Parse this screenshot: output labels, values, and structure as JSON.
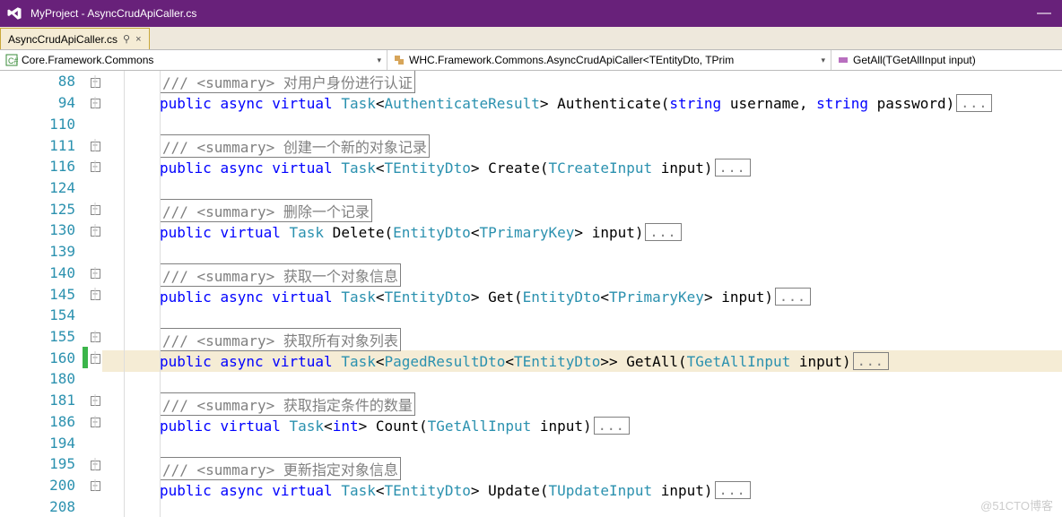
{
  "titlebar": {
    "title": "MyProject - AsyncCrudApiCaller.cs"
  },
  "tab": {
    "label": "AsyncCrudApiCaller.cs",
    "pin_glyph": "⚲",
    "close_glyph": "×"
  },
  "nav": {
    "namespace": "Core.Framework.Commons",
    "class": "WHC.Framework.Commons.AsyncCrudApiCaller<TEntityDto, TPrim",
    "member": "GetAll(TGetAllInput input)"
  },
  "lines": [
    {
      "n": 88,
      "expand": true,
      "kind": "summary",
      "summary": " 对用户身份进行认证"
    },
    {
      "n": 94,
      "expand": true,
      "kind": "sig",
      "tokens": [
        [
          "kw",
          "public"
        ],
        [
          "sp",
          " "
        ],
        [
          "kw",
          "async"
        ],
        [
          "sp",
          " "
        ],
        [
          "kw",
          "virtual"
        ],
        [
          "sp",
          " "
        ],
        [
          "type",
          "Task"
        ],
        [
          "pl",
          "<"
        ],
        [
          "type",
          "AuthenticateResult"
        ],
        [
          "pl",
          "> Authenticate("
        ],
        [
          "kw",
          "string"
        ],
        [
          "pl",
          " username, "
        ],
        [
          "kw",
          "string"
        ],
        [
          "pl",
          " password)"
        ]
      ],
      "ellipsis": true
    },
    {
      "n": 110,
      "kind": "blank"
    },
    {
      "n": 111,
      "expand": true,
      "kind": "summary",
      "summary": " 创建一个新的对象记录"
    },
    {
      "n": 116,
      "expand": true,
      "kind": "sig",
      "tokens": [
        [
          "kw",
          "public"
        ],
        [
          "sp",
          " "
        ],
        [
          "kw",
          "async"
        ],
        [
          "sp",
          " "
        ],
        [
          "kw",
          "virtual"
        ],
        [
          "sp",
          " "
        ],
        [
          "type",
          "Task"
        ],
        [
          "pl",
          "<"
        ],
        [
          "type",
          "TEntityDto"
        ],
        [
          "pl",
          "> Create("
        ],
        [
          "type",
          "TCreateInput"
        ],
        [
          "pl",
          " input)"
        ]
      ],
      "ellipsis": true
    },
    {
      "n": 124,
      "kind": "blank"
    },
    {
      "n": 125,
      "expand": true,
      "kind": "summary",
      "summary": " 删除一个记录"
    },
    {
      "n": 130,
      "expand": true,
      "kind": "sig",
      "tokens": [
        [
          "kw",
          "public"
        ],
        [
          "sp",
          " "
        ],
        [
          "kw",
          "virtual"
        ],
        [
          "sp",
          " "
        ],
        [
          "type",
          "Task"
        ],
        [
          "pl",
          " Delete("
        ],
        [
          "type",
          "EntityDto"
        ],
        [
          "pl",
          "<"
        ],
        [
          "type",
          "TPrimaryKey"
        ],
        [
          "pl",
          "> input)"
        ]
      ],
      "ellipsis": true
    },
    {
      "n": 139,
      "kind": "blank"
    },
    {
      "n": 140,
      "expand": true,
      "kind": "summary",
      "summary": " 获取一个对象信息"
    },
    {
      "n": 145,
      "expand": true,
      "kind": "sig",
      "tokens": [
        [
          "kw",
          "public"
        ],
        [
          "sp",
          " "
        ],
        [
          "kw",
          "async"
        ],
        [
          "sp",
          " "
        ],
        [
          "kw",
          "virtual"
        ],
        [
          "sp",
          " "
        ],
        [
          "type",
          "Task"
        ],
        [
          "pl",
          "<"
        ],
        [
          "type",
          "TEntityDto"
        ],
        [
          "pl",
          "> Get("
        ],
        [
          "type",
          "EntityDto"
        ],
        [
          "pl",
          "<"
        ],
        [
          "type",
          "TPrimaryKey"
        ],
        [
          "pl",
          "> input)"
        ]
      ],
      "ellipsis": true
    },
    {
      "n": 154,
      "kind": "blank"
    },
    {
      "n": 155,
      "expand": true,
      "kind": "summary",
      "summary": " 获取所有对象列表"
    },
    {
      "n": 160,
      "expand": true,
      "highlight": true,
      "marker": "green",
      "kind": "sig",
      "tokens": [
        [
          "kw",
          "public"
        ],
        [
          "sp",
          " "
        ],
        [
          "kw",
          "async"
        ],
        [
          "sp",
          " "
        ],
        [
          "kw",
          "virtual"
        ],
        [
          "sp",
          " "
        ],
        [
          "type",
          "Task"
        ],
        [
          "pl",
          "<"
        ],
        [
          "type",
          "PagedResultDto"
        ],
        [
          "pl",
          "<"
        ],
        [
          "type",
          "TEntityDto"
        ],
        [
          "pl",
          ">> GetAll("
        ],
        [
          "type",
          "TGetAllInput"
        ],
        [
          "pl",
          " input)"
        ]
      ],
      "ellipsis": true
    },
    {
      "n": 180,
      "kind": "blank"
    },
    {
      "n": 181,
      "expand": true,
      "kind": "summary",
      "summary": " 获取指定条件的数量"
    },
    {
      "n": 186,
      "expand": true,
      "kind": "sig",
      "tokens": [
        [
          "kw",
          "public"
        ],
        [
          "sp",
          " "
        ],
        [
          "kw",
          "virtual"
        ],
        [
          "sp",
          " "
        ],
        [
          "type",
          "Task"
        ],
        [
          "pl",
          "<"
        ],
        [
          "kw",
          "int"
        ],
        [
          "pl",
          "> Count("
        ],
        [
          "type",
          "TGetAllInput"
        ],
        [
          "pl",
          " input)"
        ]
      ],
      "ellipsis": true
    },
    {
      "n": 194,
      "kind": "blank"
    },
    {
      "n": 195,
      "expand": true,
      "kind": "summary",
      "summary": " 更新指定对象信息"
    },
    {
      "n": 200,
      "expand": true,
      "kind": "sig",
      "tokens": [
        [
          "kw",
          "public"
        ],
        [
          "sp",
          " "
        ],
        [
          "kw",
          "async"
        ],
        [
          "sp",
          " "
        ],
        [
          "kw",
          "virtual"
        ],
        [
          "sp",
          " "
        ],
        [
          "type",
          "Task"
        ],
        [
          "pl",
          "<"
        ],
        [
          "type",
          "TEntityDto"
        ],
        [
          "pl",
          "> Update("
        ],
        [
          "type",
          "TUpdateInput"
        ],
        [
          "pl",
          " input)"
        ]
      ],
      "ellipsis": true
    },
    {
      "n": 208,
      "kind": "blank"
    }
  ],
  "summary_prefix": "/// <summary>",
  "ellipsis_glyph": "...",
  "watermark": "@51CTO博客"
}
